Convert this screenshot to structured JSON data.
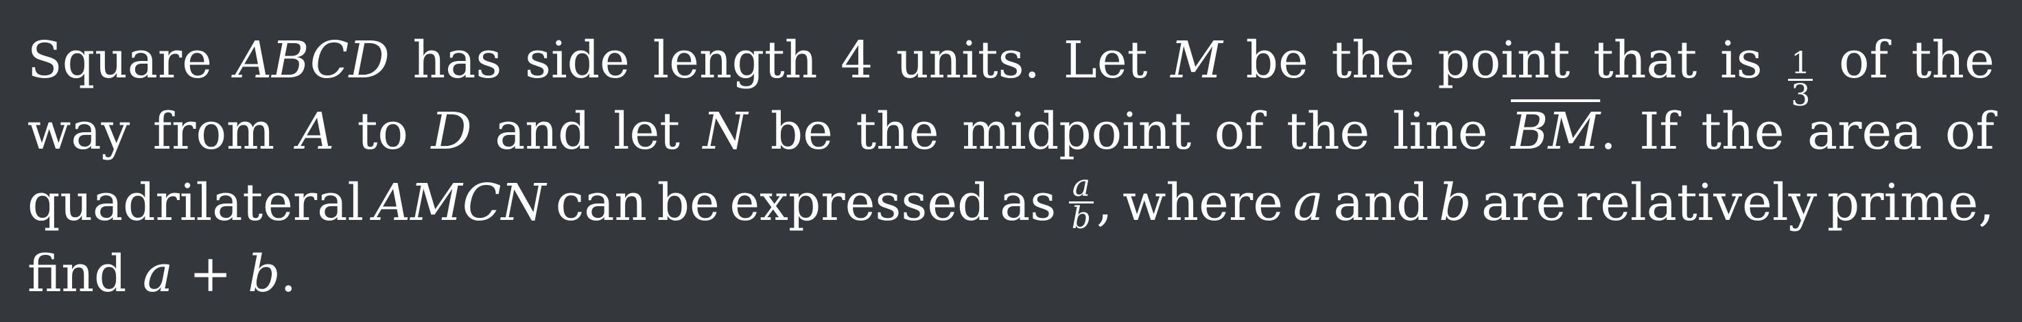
{
  "problem": {
    "line1": {
      "w1": "Square",
      "v_square": "ABCD",
      "w2": "has",
      "w3": "side",
      "w4": "length",
      "w5": "4",
      "w6": "units.",
      "w7": "Let",
      "v_m": "M",
      "w8": "be",
      "w9": "the",
      "w10": "point",
      "w11": "that",
      "w12": "is",
      "frac_num": "1",
      "frac_den": "3",
      "w13": "of",
      "w14": "the"
    },
    "line2": {
      "w1": "way",
      "w2": "from",
      "v_a": "A",
      "w3": "to",
      "v_d": "D",
      "w4": "and",
      "w5": "let",
      "v_n": "N",
      "w6": "be",
      "w7": "the",
      "w8": "midpoint",
      "w9": "of",
      "w10": "the",
      "w11": "line",
      "v_bm": "BM",
      "punct": ".",
      "w12": "If",
      "w13": "the",
      "w14": "area",
      "w15": "of"
    },
    "line3": {
      "w1": "quadrilateral",
      "v_amcn": "AMCN",
      "w2": "can",
      "w3": "be",
      "w4": "expressed",
      "w5": "as",
      "frac_num": "a",
      "frac_den": "b",
      "comma": ",",
      "w6": "where",
      "v_a": "a",
      "w7": "and",
      "v_b": "b",
      "w8": "are",
      "w9": "relatively",
      "w10": "prime,"
    },
    "line4": {
      "w1": "find",
      "expr": "a + b",
      "punct": "."
    }
  }
}
